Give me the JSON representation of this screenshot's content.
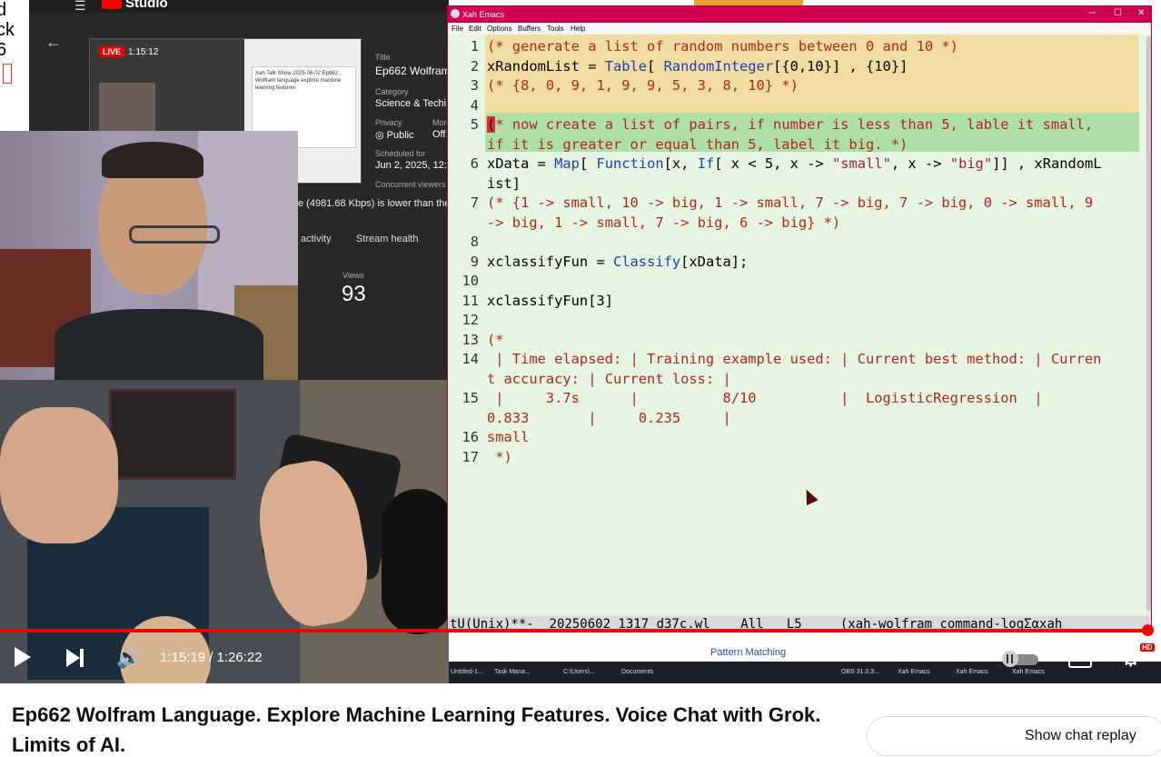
{
  "studio": {
    "strip_lines": [
      "d",
      "ck",
      "6"
    ],
    "logo_text": "Studio",
    "live_badge": "LIVE",
    "live_time": "1:15:12",
    "title_label": "Title",
    "title_value": "Ep662 Wolfram",
    "category_label": "Category",
    "category_value": "Science & Techi",
    "privacy_label": "Privacy",
    "privacy_value": "Public",
    "more_label": "Mor",
    "more_value": "Off",
    "scheduled_label": "Scheduled for",
    "scheduled_value": "Jun 2, 2025, 12:",
    "concurrent_label": "Concurrent viewers",
    "bitrate_text": "e (4981.68 Kbps) is lower than the",
    "tab_activity": "activity",
    "tab_stream_health": "Stream health",
    "views_label": "Views",
    "views_value": "93",
    "preview_page_text": "Xah Talk Show 2025-06-02 Ep662 Wolfram language explore machine learning features"
  },
  "emacs": {
    "window_title": "Xah Emacs",
    "menu": [
      "File",
      "Edit",
      "Options",
      "Buffers",
      "Tools",
      "Help"
    ],
    "lines": [
      {
        "n": "1",
        "segments": [
          {
            "t": "(* generate a list of random numbers between 0 and 10 *)",
            "c": "cmt"
          }
        ]
      },
      {
        "n": "2",
        "segments": [
          {
            "t": "xRandomList = ",
            "c": ""
          },
          {
            "t": "Table",
            "c": "kw"
          },
          {
            "t": "[ ",
            "c": ""
          },
          {
            "t": "RandomInteger",
            "c": "kw"
          },
          {
            "t": "[{0,10}] , {10}]",
            "c": ""
          }
        ]
      },
      {
        "n": "3",
        "segments": [
          {
            "t": "(* {8, 0, 9, 1, 9, 9, 5, 3, 8, 10} *)",
            "c": "cmt"
          }
        ]
      },
      {
        "n": "4",
        "segments": []
      },
      {
        "n": "5",
        "segments": [
          {
            "t": "(",
            "c": "cursor"
          },
          {
            "t": "* now create a list of pairs, if number is less than 5, lable it small,",
            "c": "cmt"
          }
        ]
      },
      {
        "n": "",
        "segments": [
          {
            "t": "if it is greater or equal than 5, label it big. *)",
            "c": "cmt"
          }
        ]
      },
      {
        "n": "6",
        "segments": [
          {
            "t": "xData = ",
            "c": ""
          },
          {
            "t": "Map",
            "c": "kw"
          },
          {
            "t": "[ ",
            "c": ""
          },
          {
            "t": "Function",
            "c": "kw"
          },
          {
            "t": "[x, ",
            "c": ""
          },
          {
            "t": "If",
            "c": "kw"
          },
          {
            "t": "[ x < 5, x -> ",
            "c": ""
          },
          {
            "t": "\"small\"",
            "c": "str"
          },
          {
            "t": ", x -> ",
            "c": ""
          },
          {
            "t": "\"big\"",
            "c": "str"
          },
          {
            "t": "]] , xRandomL",
            "c": ""
          }
        ]
      },
      {
        "n": "",
        "segments": [
          {
            "t": "ist]",
            "c": ""
          }
        ]
      },
      {
        "n": "7",
        "segments": [
          {
            "t": "(* {1 -> small, 10 -> big, 1 -> small, 7 -> big, 7 -> big, 0 -> small, 9",
            "c": "cmt"
          }
        ]
      },
      {
        "n": "",
        "segments": [
          {
            "t": "-> big, 1 -> small, 7 -> big, 6 -> big} *)",
            "c": "cmt"
          }
        ]
      },
      {
        "n": "8",
        "segments": []
      },
      {
        "n": "9",
        "segments": [
          {
            "t": "xclassifyFun = ",
            "c": ""
          },
          {
            "t": "Classify",
            "c": "kw"
          },
          {
            "t": "[xData];",
            "c": ""
          }
        ]
      },
      {
        "n": "10",
        "segments": []
      },
      {
        "n": "11",
        "segments": [
          {
            "t": "xclassifyFun[3]",
            "c": ""
          }
        ]
      },
      {
        "n": "12",
        "segments": []
      },
      {
        "n": "13",
        "segments": [
          {
            "t": "(*",
            "c": "cmt"
          }
        ]
      },
      {
        "n": "14",
        "segments": [
          {
            "t": " | Time elapsed: | Training example used: | Current best method: | Curren",
            "c": "cmt"
          }
        ]
      },
      {
        "n": "",
        "segments": [
          {
            "t": "t accuracy: | Current loss: |",
            "c": "cmt"
          }
        ]
      },
      {
        "n": "15",
        "segments": [
          {
            "t": " |     3.7s      |          8/10          |  LogisticRegression  |",
            "c": "cmt"
          }
        ]
      },
      {
        "n": "",
        "segments": [
          {
            "t": "0.833       |     0.235     |",
            "c": "cmt"
          }
        ]
      },
      {
        "n": "16",
        "segments": [
          {
            "t": "small",
            "c": "cmt"
          }
        ]
      },
      {
        "n": "17",
        "segments": [
          {
            "t": " *)",
            "c": "cmt"
          }
        ]
      }
    ],
    "modeline": "tU(Unix)**-  20250602_1317_d37c.wl    All   L5     (xah-wolfram command-logΣαxah"
  },
  "taskbar": {
    "items": [
      "Untitled-1...",
      "Task Mana...",
      "C:\\Users\\...",
      "Documents",
      "OBS 31.0.3...",
      "Xah Emacs",
      "Xah Emacs",
      "Xah Emacs"
    ],
    "pattern_text": "Pattern Matching"
  },
  "player": {
    "current_time": "1:15:19",
    "separator": " / ",
    "duration": "1:26:22",
    "time_text": "1:15:19 / 1:26:22",
    "progress_fraction": 0.871,
    "cc_label": "CC",
    "hd_badge": "HD",
    "accent_color": "#ff0000"
  },
  "video": {
    "title": "Ep662 Wolfram Language. Explore Machine Learning Features. Voice Chat with Grok. Limits of AI.",
    "show_chat_replay": "Show chat replay"
  },
  "icons": [
    "menu-icon",
    "back-arrow-icon",
    "play-icon",
    "next-icon",
    "volume-icon",
    "cc-icon",
    "settings-icon",
    "globe-icon"
  ]
}
